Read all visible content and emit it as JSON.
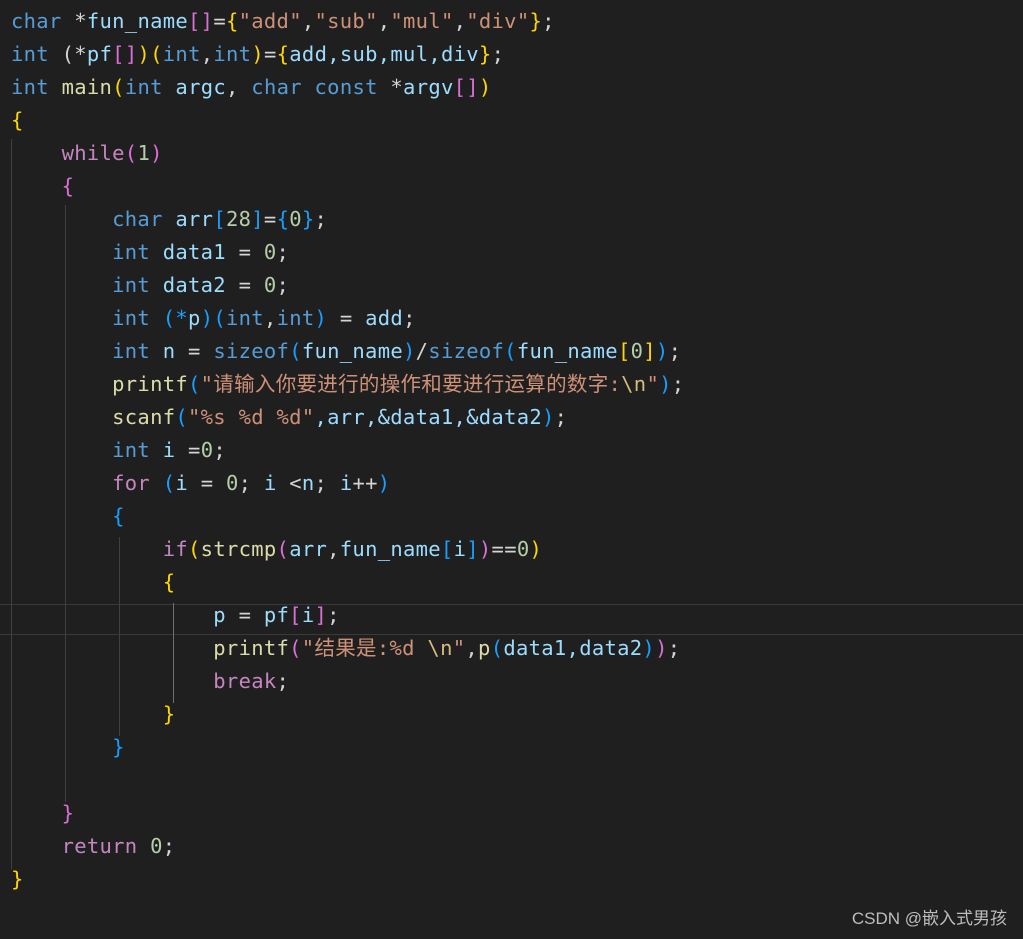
{
  "editor": {
    "lines": [
      [
        "char",
        " *",
        "fun_name",
        "[]",
        "=",
        "{",
        "\"add\"",
        ",",
        "\"sub\"",
        ",",
        "\"mul\"",
        ",",
        "\"div\"",
        "}",
        ";"
      ],
      [
        "int",
        " (*",
        "pf",
        "[]",
        ")",
        "(",
        "int",
        ",",
        "int",
        ")",
        "=",
        "{",
        "add,sub,mul,div",
        "}",
        ";"
      ],
      [
        "int",
        " ",
        "main",
        "(",
        "int",
        " ",
        "argc",
        ", ",
        "char",
        " ",
        "const",
        " *",
        "argv",
        "[]",
        ")"
      ],
      [
        "{"
      ],
      [
        "    ",
        "while",
        "(",
        "1",
        ")"
      ],
      [
        "    ",
        "{"
      ],
      [
        "        ",
        "char",
        " ",
        "arr",
        "[",
        "28",
        "]",
        "=",
        "{",
        "0",
        "}",
        ";"
      ],
      [
        "        ",
        "int",
        " ",
        "data1",
        " = ",
        "0",
        ";"
      ],
      [
        "        ",
        "int",
        " ",
        "data2",
        " = ",
        "0",
        ";"
      ],
      [
        "        ",
        "int",
        " ",
        "(*",
        "p",
        ")",
        "(",
        "int",
        ",",
        "int",
        ")",
        " = ",
        "add",
        ";"
      ],
      [
        "        ",
        "int",
        " ",
        "n",
        " = ",
        "sizeof",
        "(",
        "fun_name",
        ")",
        "/",
        "sizeof",
        "(",
        "fun_name",
        "[",
        "0",
        "]",
        ")",
        ";"
      ],
      [
        "        ",
        "printf",
        "(",
        "\"请输入你要进行的操作和要进行运算的数字:",
        "\\n",
        "\"",
        ")",
        ";"
      ],
      [
        "        ",
        "scanf",
        "(",
        "\"%s %d %d\"",
        ",arr,&data1,&data2",
        ")",
        ";"
      ],
      [
        "        ",
        "int",
        " ",
        "i",
        " =",
        "0",
        ";"
      ],
      [
        "        ",
        "for",
        " ",
        "(",
        "i",
        " = ",
        "0",
        "; ",
        "i",
        " <",
        "n",
        "; ",
        "i",
        "++",
        ")"
      ],
      [
        "        ",
        "{"
      ],
      [
        "            ",
        "if",
        "(",
        "strcmp",
        "(",
        "arr",
        ",",
        "fun_name",
        "[",
        "i",
        "]",
        ")",
        "==",
        "0",
        ")"
      ],
      [
        "            ",
        "{"
      ],
      [
        "                ",
        "p",
        " = ",
        "pf",
        "[",
        "i",
        "]",
        ";"
      ],
      [
        "                ",
        "printf",
        "(",
        "\"结果是:%d ",
        "\\n",
        "\"",
        ",",
        "p",
        "(",
        "data1,data2",
        ")",
        ")",
        ";"
      ],
      [
        "                ",
        "break",
        ";"
      ],
      [
        "            ",
        "}"
      ],
      [
        "        ",
        "}"
      ],
      [
        ""
      ],
      [
        "    ",
        "}"
      ],
      [
        "    ",
        "return",
        " ",
        "0",
        ";"
      ],
      [
        "}"
      ]
    ],
    "classes": [
      [
        "kw-type",
        "op",
        "var",
        "b2",
        "op",
        "b1",
        "str",
        "op",
        "str",
        "op",
        "str",
        "op",
        "str",
        "b1",
        "op"
      ],
      [
        "kw-type",
        "op",
        "var",
        "b2",
        "b1",
        "b1",
        "kw-type",
        "op",
        "kw-type",
        "b1",
        "op",
        "b1",
        "var",
        "b1",
        "op"
      ],
      [
        "kw-type",
        "op",
        "fn",
        "b1",
        "kw-type",
        "op",
        "var",
        "op",
        "kw-type",
        "op",
        "kw-type",
        "op",
        "var",
        "b2",
        "b1"
      ],
      [
        "b1"
      ],
      [
        "op",
        "kw-ctrl",
        "b2",
        "num",
        "b2"
      ],
      [
        "op",
        "b2"
      ],
      [
        "op",
        "kw-type",
        "op",
        "var",
        "b3",
        "num",
        "b3",
        "op",
        "b3",
        "num",
        "b3",
        "op"
      ],
      [
        "op",
        "kw-type",
        "op",
        "var",
        "op",
        "num",
        "op"
      ],
      [
        "op",
        "kw-type",
        "op",
        "var",
        "op",
        "num",
        "op"
      ],
      [
        "op",
        "kw-type",
        "op",
        "b3",
        "var",
        "b3",
        "b3",
        "kw-type",
        "op",
        "kw-type",
        "b3",
        "op",
        "var",
        "op"
      ],
      [
        "op",
        "kw-type",
        "op",
        "var",
        "op",
        "kw-type",
        "b3",
        "var",
        "b3",
        "op",
        "kw-type",
        "b3",
        "var",
        "b1",
        "num",
        "b1",
        "b3",
        "op"
      ],
      [
        "op",
        "fn",
        "b3",
        "str",
        "esc",
        "str",
        "b3",
        "op"
      ],
      [
        "op",
        "fn",
        "b3",
        "str",
        "var",
        "b3",
        "op"
      ],
      [
        "op",
        "kw-type",
        "op",
        "var",
        "op",
        "num",
        "op"
      ],
      [
        "op",
        "kw-ctrl",
        "op",
        "b3",
        "var",
        "op",
        "num",
        "op",
        "var",
        "op",
        "var",
        "op",
        "var",
        "op",
        "b3"
      ],
      [
        "op",
        "b3"
      ],
      [
        "op",
        "kw-ctrl",
        "b1",
        "fn",
        "b2",
        "var",
        "op",
        "var",
        "b3",
        "var",
        "b3",
        "b2",
        "op",
        "num",
        "b1"
      ],
      [
        "op",
        "b1"
      ],
      [
        "op",
        "var",
        "op",
        "var",
        "b2",
        "var",
        "b2",
        "op"
      ],
      [
        "op",
        "fn",
        "b2",
        "str",
        "esc",
        "str",
        "op",
        "fn",
        "b3",
        "var",
        "b3",
        "b2",
        "op"
      ],
      [
        "op",
        "kw-ctrl",
        "op"
      ],
      [
        "op",
        "b1"
      ],
      [
        "op",
        "b3"
      ],
      [
        "op"
      ],
      [
        "op",
        "b2"
      ],
      [
        "op",
        "kw-ctrl",
        "op",
        "num",
        "op"
      ],
      [
        "b1"
      ]
    ]
  },
  "watermark": "CSDN @嵌入式男孩"
}
